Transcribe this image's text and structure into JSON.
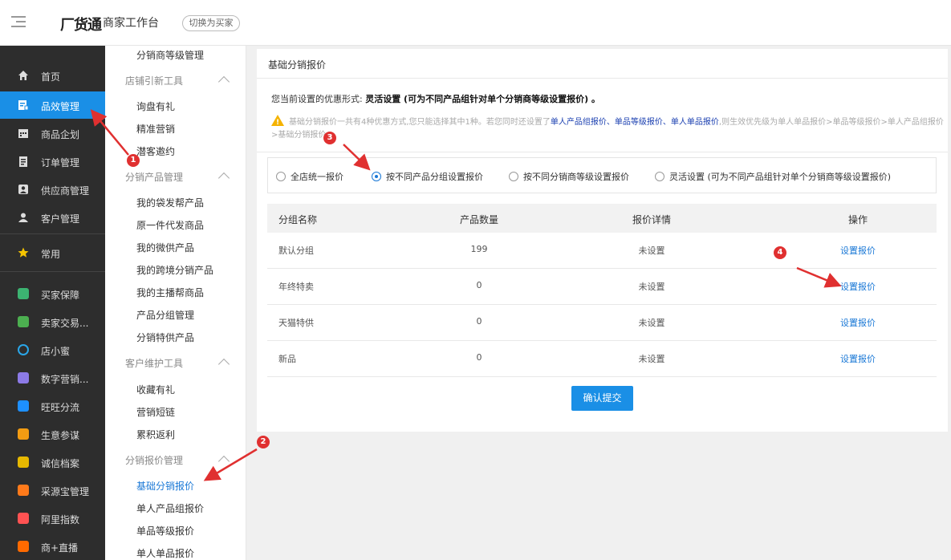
{
  "header": {
    "logo": "厂货通",
    "subtitle": "商家工作台",
    "switch_label": "切换为买家"
  },
  "sidebar": {
    "items": [
      {
        "label": "首页",
        "icon": "home-icon"
      },
      {
        "label": "品效管理",
        "icon": "product-effect-icon",
        "active": true
      },
      {
        "label": "商品企划",
        "icon": "calendar-icon"
      },
      {
        "label": "订单管理",
        "icon": "clipboard-icon"
      },
      {
        "label": "供应商管理",
        "icon": "supplier-icon"
      },
      {
        "label": "客户管理",
        "icon": "user-icon"
      },
      {
        "label": "常用",
        "icon": "star-icon"
      },
      {
        "label": "买家保障",
        "icon": "shield-icon"
      },
      {
        "label": "卖家交易...",
        "icon": "seller-icon"
      },
      {
        "label": "店小蜜",
        "icon": "bot-icon"
      },
      {
        "label": "数字营销...",
        "icon": "digital-marketing-icon"
      },
      {
        "label": "旺旺分流",
        "icon": "wangwang-icon"
      },
      {
        "label": "生意参谋",
        "icon": "compass-icon"
      },
      {
        "label": "诚信档案",
        "icon": "credit-icon"
      },
      {
        "label": "采源宝管理",
        "icon": "caiyuanbao-icon"
      },
      {
        "label": "阿里指数",
        "icon": "chart-icon"
      },
      {
        "label": "商+直播",
        "icon": "live-icon"
      }
    ]
  },
  "subnav": {
    "top_item": "分销商等级管理",
    "groups": [
      {
        "title": "店铺引新工具",
        "items": [
          "询盘有礼",
          "精准营销",
          "潜客邀约"
        ]
      },
      {
        "title": "分销产品管理",
        "items": [
          "我的袋发帮产品",
          "原一件代发商品",
          "我的微供产品",
          "我的跨境分销产品",
          "我的主播帮商品",
          "产品分组管理",
          "分销特供产品"
        ]
      },
      {
        "title": "客户维护工具",
        "items": [
          "收藏有礼",
          "营销短链",
          "累积返利"
        ]
      },
      {
        "title": "分销报价管理",
        "items": [
          "基础分销报价",
          "单人产品组报价",
          "单品等级报价",
          "单人单品报价"
        ]
      }
    ]
  },
  "main": {
    "title": "基础分销报价",
    "current_mode_label": "您当前设置的优惠形式:",
    "current_mode_value": "灵活设置 (可为不同产品组针对单个分销商等级设置报价) 。",
    "notice": {
      "prefix": "基础分销报价一共有4种优惠方式,您只能选择其中1种。若您同时还设置了",
      "link1": "单人产品组报价、",
      "link2": "单品等级报价、",
      "link3": "单人单品报价",
      "suffix": ",则生效优先级为单人单品报价>单品等级报价>单人产品组报价>基础分销报价。"
    },
    "radio_options": [
      {
        "label": "全店统一报价",
        "checked": false
      },
      {
        "label": "按不同产品分组设置报价",
        "checked": true
      },
      {
        "label": "按不同分销商等级设置报价",
        "checked": false
      },
      {
        "label": "灵活设置 (可为不同产品组针对单个分销商等级设置报价)",
        "checked": false
      }
    ],
    "table": {
      "headers": [
        "分组名称",
        "产品数量",
        "报价详情",
        "操作"
      ],
      "rows": [
        {
          "name": "默认分组",
          "count": "199",
          "detail": "未设置",
          "action": "设置报价"
        },
        {
          "name": "年终特卖",
          "count": "0",
          "detail": "未设置",
          "action": "设置报价"
        },
        {
          "name": "天猫特供",
          "count": "0",
          "detail": "未设置",
          "action": "设置报价"
        },
        {
          "name": "新品",
          "count": "0",
          "detail": "未设置",
          "action": "设置报价"
        }
      ]
    },
    "submit_label": "确认提交"
  },
  "annotations": [
    "1",
    "2",
    "3",
    "4"
  ],
  "colors": {
    "accent": "#1a8fe6",
    "sidebar_bg": "#2d2d2d",
    "marker": "#e03030"
  }
}
